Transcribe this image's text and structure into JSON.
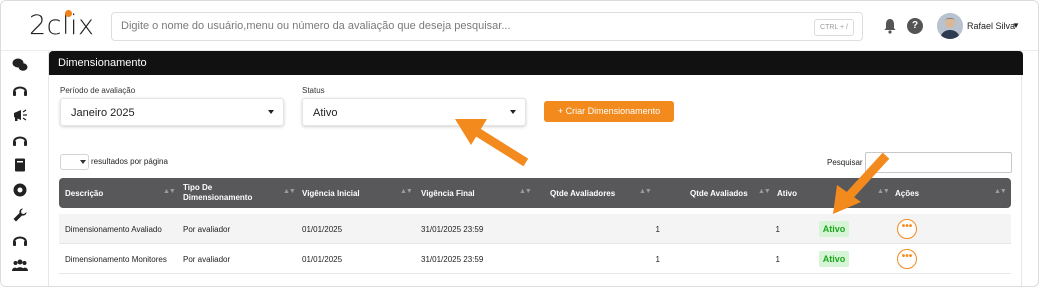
{
  "app": {
    "logo_text": "2clix",
    "search_placeholder": "Digite o nome do usuário,menu ou número da avaliação que deseja pesquisar...",
    "search_shortcut": "CTRL + /",
    "help_glyph": "?",
    "user_name": "Rafael Silva",
    "accent_color": "#f28a1e"
  },
  "panel": {
    "title": "Dimensionamento",
    "period_label": "Período de avaliação",
    "period_value": "Janeiro 2025",
    "status_label": "Status",
    "status_value": "Ativo",
    "create_button": "+ Criar Dimensionamento",
    "rpp_label": "resultados por página",
    "search_label": "Pesquisar"
  },
  "table": {
    "columns": [
      "Descrição",
      "Tipo De Dimensionamento",
      "Vigência Inicial",
      "Vigência Final",
      "Qtde Avaliadores",
      "Qtde Avaliados",
      "Ativo",
      "Ações"
    ],
    "rows": [
      {
        "descricao": "Dimensionamento Avaliado",
        "tipo": "Por avaliador",
        "inicio": "01/01/2025",
        "fim": "31/01/2025 23:59",
        "avaliadores": "1",
        "avaliados": "1",
        "ativo": "Ativo",
        "acoes": "•••"
      },
      {
        "descricao": "Dimensionamento Monitores",
        "tipo": "Por avaliador",
        "inicio": "01/01/2025",
        "fim": "31/01/2025 23:59",
        "avaliadores": "1",
        "avaliados": "1",
        "ativo": "Ativo",
        "acoes": "•••"
      }
    ]
  },
  "sidebar_icons": [
    "chat-icon",
    "headset-icon",
    "megaphone-icon",
    "headset-icon",
    "book-icon",
    "badge-icon",
    "wrench-icon",
    "headset-icon",
    "team-icon"
  ]
}
